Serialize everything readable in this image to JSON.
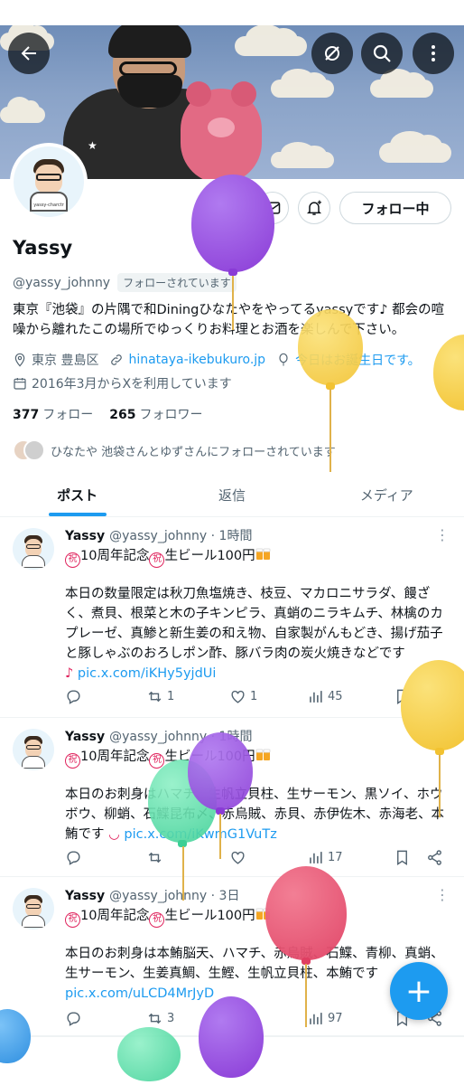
{
  "header": {
    "back_icon": "arrow-left-icon",
    "mute_icon": "no-notifications-icon",
    "search_icon": "search-icon",
    "more_icon": "more-vertical-icon"
  },
  "profile": {
    "name": "Yassy",
    "handle": "@yassy_johnny",
    "follows_you": "フォローされています",
    "follow_button": "フォロー中",
    "bio": "東京『池袋』の片隅で和Diningひなたやをやってるyassyです♪ 都会の喧噪から離れたこの場所でゆっくりお料理とお酒を楽しんで下さい。",
    "location": "東京 豊島区",
    "website": "hinataya-ikebukuro.jp",
    "birthday": "今日はお誕生日です。",
    "joined": "2016年3月からXを利用しています",
    "following_count": "377",
    "following_label": "フォロー",
    "followers_count": "265",
    "followers_label": "フォロワー",
    "followed_by": "ひなたや 池袋さんとゆずさんにフォローされています",
    "avatar_caption": "yassy-charctr"
  },
  "tabs": [
    "ポスト",
    "返信",
    "メディア"
  ],
  "posts": [
    {
      "name": "Yassy",
      "handle": "@yassy_johnny",
      "time": "· 1時間",
      "title_a": "10周年記念",
      "title_b": "生ビール100円",
      "text": "本日の数量限定は秋刀魚塩焼き、枝豆、マカロニサラダ、饅ざく、煮貝、根菜と木の子キンピラ、真蛸のニラキムチ、林檎のカプレーゼ、真鯵と新生姜の和え物、自家製がんもどき、揚げ茄子と豚しゃぶのおろしポン酢、豚バラ肉の炭火焼きなどです",
      "link": "pic.x.com/iKHy5yjdUi",
      "replies": "",
      "reposts": "1",
      "likes": "1",
      "views": "45"
    },
    {
      "name": "Yassy",
      "handle": "@yassy_johnny",
      "time": "· 1時間",
      "title_a": "10周年記念",
      "title_b": "生ビール100円",
      "text": "本日のお刺身はハマチ、生帆立貝柱、生サーモン、黒ソイ、ホウボウ、柳蛸、石鰈昆布〆、赤烏賊、赤貝、赤伊佐木、赤海老、本鮪です",
      "link": "pic.x.com/iKwmG1VuTz",
      "replies": "",
      "reposts": "",
      "likes": "",
      "views": "17"
    },
    {
      "name": "Yassy",
      "handle": "@yassy_johnny",
      "time": "· 3日",
      "title_a": "10周年記念",
      "title_b": "生ビール100円",
      "text": "本日のお刺身は本鮪脳天、ハマチ、赤烏賊、石鰈、青柳、真蛸、生サーモン、生姜真鯛、生鰹、生帆立貝柱、本鮪です",
      "link": "pic.x.com/uLCD4MrJyD",
      "replies": "",
      "reposts": "3",
      "likes": "4",
      "views": "97"
    }
  ],
  "compose_icon": "plus-icon",
  "colors": {
    "accent": "#1d9bf0",
    "text": "#0f1419",
    "muted": "#536471",
    "balloon_purple": "#9b4fe0",
    "balloon_yellow": "#f5c93c",
    "balloon_green": "#4fd6a0",
    "balloon_red": "#e24b6a",
    "balloon_blue": "#3fa1ee"
  }
}
